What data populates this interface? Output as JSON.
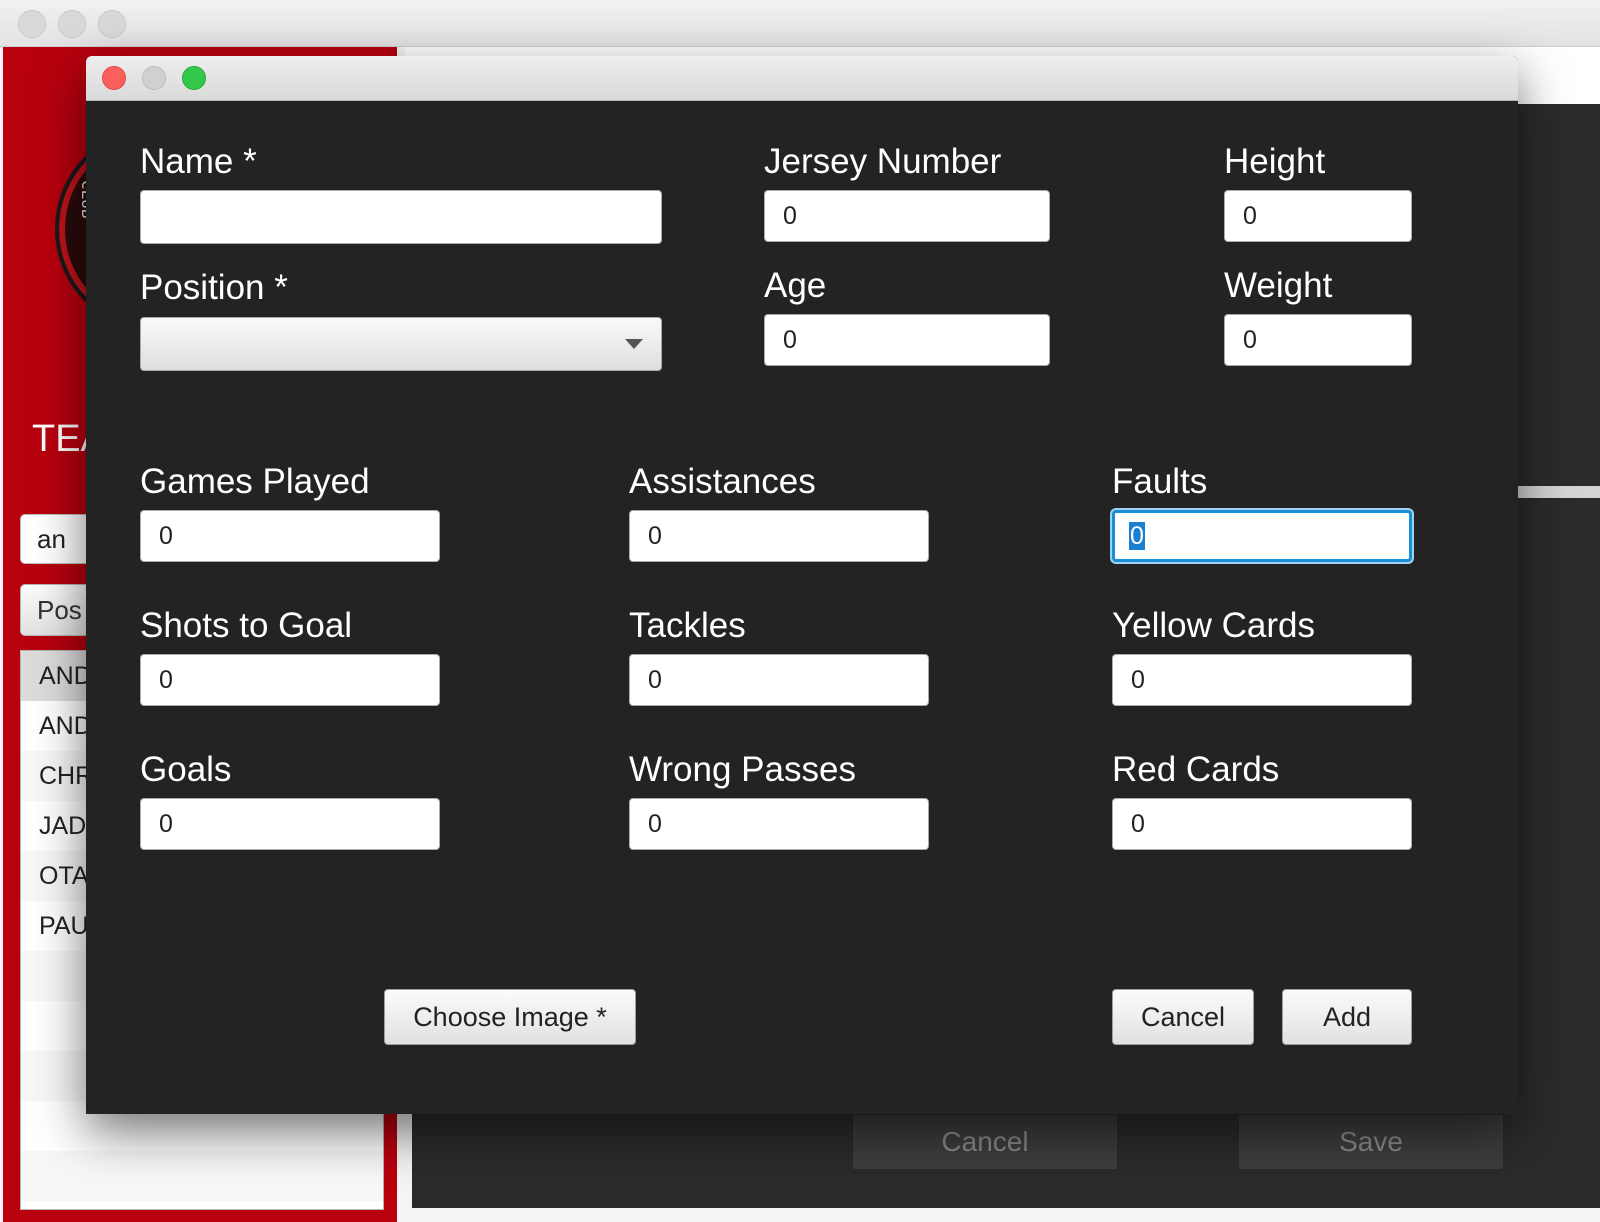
{
  "background_window": {
    "team_label": "TEA",
    "logo_text": "CLUB",
    "search_value": "an",
    "position_filter_label": "Pos",
    "players": [
      "AND",
      "AND",
      "CHR",
      "JAD",
      "OTA",
      "PAU"
    ],
    "cancel_label": "Cancel",
    "save_label": "Save"
  },
  "dialog": {
    "fields": {
      "name": {
        "label": "Name *",
        "value": ""
      },
      "position": {
        "label": "Position *",
        "value": ""
      },
      "jersey_number": {
        "label": "Jersey Number",
        "value": "0"
      },
      "age": {
        "label": "Age",
        "value": "0"
      },
      "height": {
        "label": "Height",
        "value": "0"
      },
      "weight": {
        "label": "Weight",
        "value": "0"
      },
      "games_played": {
        "label": "Games Played",
        "value": "0"
      },
      "assistances": {
        "label": "Assistances",
        "value": "0"
      },
      "faults": {
        "label": "Faults",
        "value": "0"
      },
      "shots_to_goal": {
        "label": "Shots to Goal",
        "value": "0"
      },
      "tackles": {
        "label": "Tackles",
        "value": "0"
      },
      "yellow_cards": {
        "label": "Yellow Cards",
        "value": "0"
      },
      "goals": {
        "label": "Goals",
        "value": "0"
      },
      "wrong_passes": {
        "label": "Wrong Passes",
        "value": "0"
      },
      "red_cards": {
        "label": "Red Cards",
        "value": "0"
      }
    },
    "buttons": {
      "choose_image": "Choose Image *",
      "cancel": "Cancel",
      "add": "Add"
    }
  },
  "colors": {
    "sidebar_red": "#b8000e",
    "dialog_bg": "#232323",
    "focus_blue": "#1b8fd6"
  }
}
